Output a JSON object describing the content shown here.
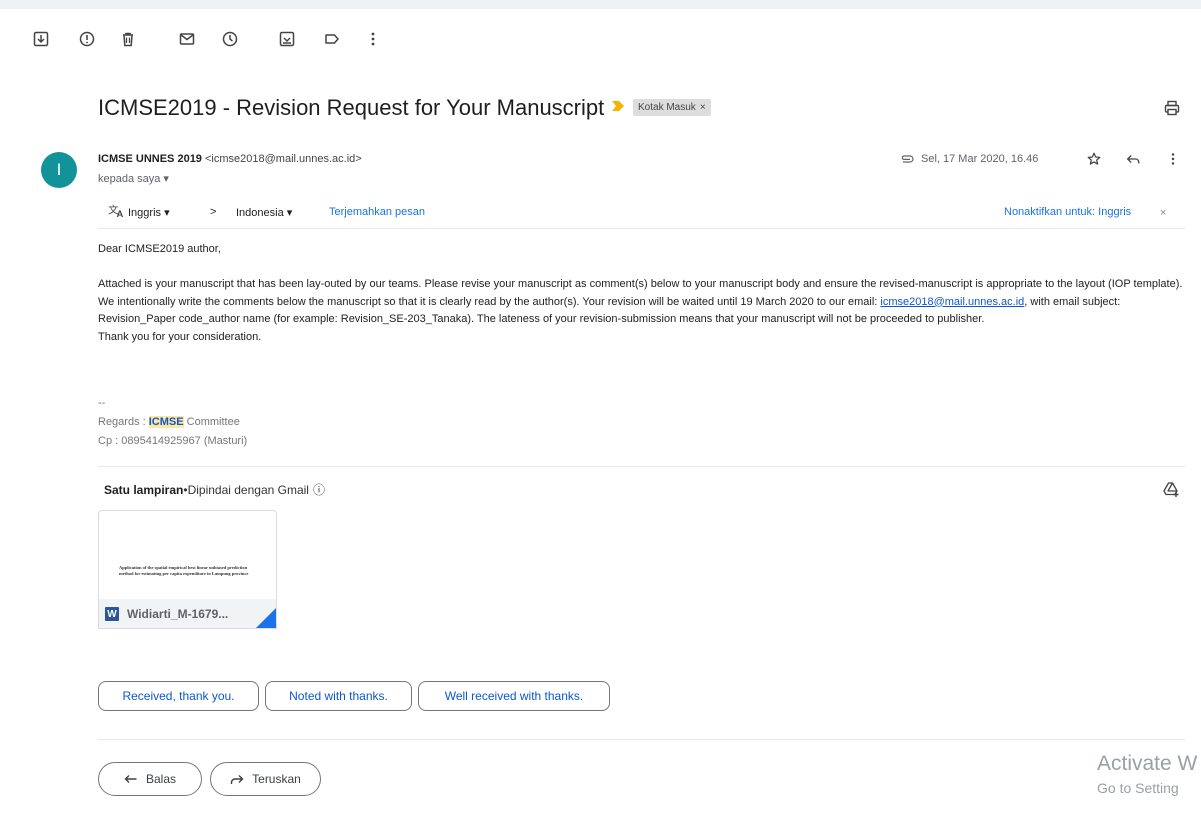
{
  "subject": "ICMSE2019 - Revision Request for Your Manuscript",
  "label": {
    "text": "Kotak Masuk",
    "close": "×"
  },
  "sender": {
    "avatar_letter": "I",
    "name": "ICMSE UNNES 2019",
    "email": "<icmse2018@mail.unnes.ac.id>",
    "to": "kepada saya ▾",
    "date": "Sel, 17 Mar 2020, 16.46"
  },
  "translate": {
    "from": "Inggris ▾",
    "chevron": ">",
    "to": "Indonesia ▾",
    "link": "Terjemahkan pesan",
    "disable": "Nonaktifkan untuk: Inggris",
    "disable_close": "×"
  },
  "body": {
    "greeting": "Dear ICMSE2019 author,",
    "para_before_link": "Attached is your manuscript that has been lay-outed by our teams. Please revise your manuscript as comment(s) below to your manuscript body and ensure the revised-manuscript is appropriate to the layout (IOP template). We intentionally write the comments below the manuscript so that it is clearly read by the author(s). Your revision will be waited until 19 March 2020 to our email: ",
    "email_link": "icmse2018@mail.unnes.ac.id",
    "para_after_link": ", with email subject: Revision_Paper code_author name (for example: Revision_SE-203_Tanaka). The lateness of your revision-submission means that your manuscript will not be proceeded to publisher.",
    "thanks": "Thank you for your consideration."
  },
  "signature": {
    "dashes": "--",
    "regards_prefix": "Regards : ",
    "regards_highlight": "ICMSE",
    "regards_suffix": " Committee",
    "contact": "Cp : 0895414925967 (Masturi)"
  },
  "attachments": {
    "heading": "Satu lampiran",
    "bullet": " • ",
    "scan_note": "Dipindai dengan Gmail",
    "info": "ⓘ",
    "file": {
      "preview_text": "Application of the spatial empirical best linear unbiased prediction method for estimating per capita expenditure in Lampung province",
      "icon_letter": "W",
      "name": "Widiarti_M-1679..."
    }
  },
  "smart_replies": [
    "Received, thank you.",
    "Noted with thanks.",
    "Well received with thanks."
  ],
  "actions": {
    "reply": "Balas",
    "forward": "Teruskan"
  },
  "watermark": {
    "line1": "Activate W",
    "line2": "Go to Setting"
  },
  "colors": {
    "avatar": "#12939a",
    "link": "#1a73e8",
    "label_arrow": "#f4b400",
    "highlight": "#fce8a1"
  }
}
